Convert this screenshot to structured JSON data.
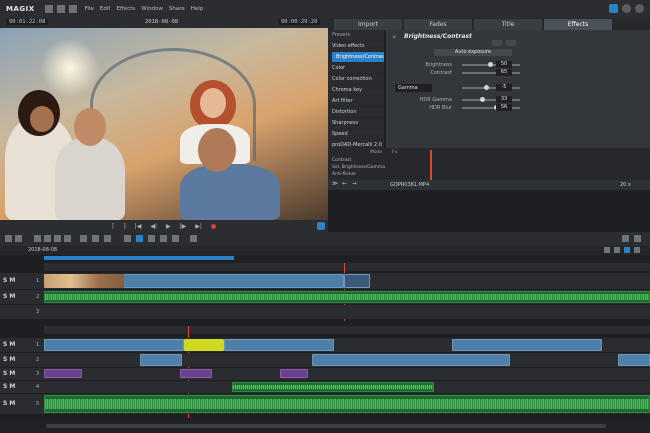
{
  "app": {
    "logo": "MAGIX",
    "menu": [
      "File",
      "Edit",
      "Effects",
      "Window",
      "Share",
      "Help"
    ]
  },
  "preview": {
    "timecode_left": "00:01:22:08",
    "date": "2018-08-08",
    "timecode_right": "00:00:29:20"
  },
  "tabs": [
    {
      "label": "Import"
    },
    {
      "label": "Fades"
    },
    {
      "label": "Title"
    },
    {
      "label": "Effects"
    }
  ],
  "presets": {
    "header": "Presets",
    "group": "Video effects",
    "items": [
      "Brightness/Contrast",
      "Color",
      "Color correction",
      "Chroma key",
      "Art filter",
      "Distortion",
      "Sharpness",
      "Speed",
      "proDAD-Mercalli 2.0"
    ]
  },
  "effect": {
    "title": "Brightness/Contrast",
    "auto_button": "Auto exposure",
    "sliders": [
      {
        "label": "Brightness",
        "value": "50"
      },
      {
        "label": "Contrast",
        "value": "65"
      }
    ],
    "gamma_select": "Gamma",
    "gamma_value": "-5",
    "sliders2": [
      {
        "label": "HDR Gamma",
        "value": "33"
      },
      {
        "label": "HDR Blur",
        "value": "56"
      }
    ]
  },
  "keyframes": {
    "rows": [
      "Contrast",
      "Sel. Brightness/Gamma",
      "Anti-flicker"
    ],
    "mode": "Mode",
    "fx": "Fx"
  },
  "status": {
    "file": "GOPR0381.MP4",
    "zoom": "20 s"
  },
  "timeline": {
    "date": "2018-08-08",
    "tracks_top": [
      {
        "label": "S M",
        "num": "1"
      },
      {
        "label": "S M",
        "num": "2"
      },
      {
        "num": "3"
      }
    ],
    "tracks_bottom": [
      {
        "label": "S M",
        "num": "1"
      },
      {
        "label": "S M",
        "num": "2"
      },
      {
        "label": "S M",
        "num": "3"
      },
      {
        "label": "S M",
        "num": "4"
      },
      {
        "label": "S M",
        "num": "5"
      }
    ]
  }
}
